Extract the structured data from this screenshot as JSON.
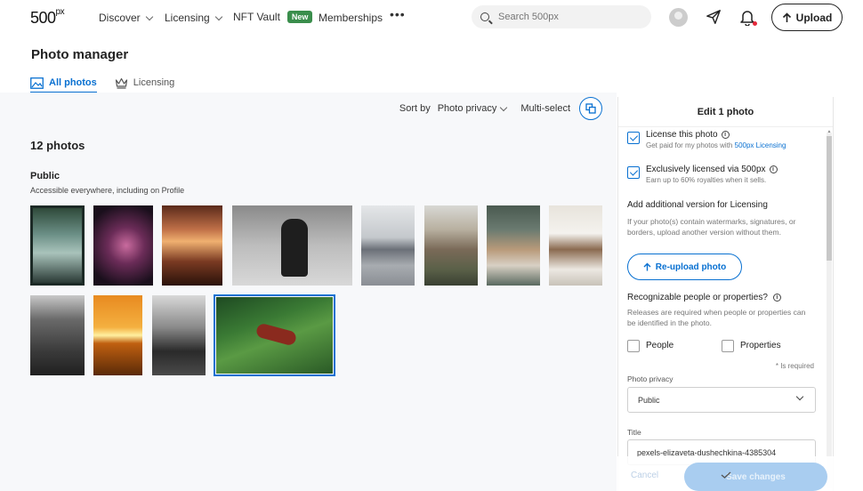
{
  "nav": {
    "logo": "500",
    "logo_suffix": "px",
    "items": [
      {
        "label": "Discover",
        "dropdown": true
      },
      {
        "label": "Licensing",
        "dropdown": true
      },
      {
        "label": "NFT Vault",
        "badge": "New"
      },
      {
        "label": "Memberships"
      }
    ],
    "more": "•••",
    "search_placeholder": "Search 500px",
    "upload_label": "Upload"
  },
  "header": {
    "title": "Photo manager",
    "tabs": [
      {
        "label": "All photos",
        "active": true,
        "icon": "image-icon"
      },
      {
        "label": "Licensing",
        "active": false,
        "icon": "crown-icon"
      }
    ]
  },
  "toolbar": {
    "sort_prefix": "Sort by",
    "sort_value": "Photo privacy",
    "multi_select": "Multi-select"
  },
  "library": {
    "count_label": "12 photos",
    "section_title": "Public",
    "section_subtitle": "Accessible everywhere, including on Profile"
  },
  "panel": {
    "title": "Edit 1 photo",
    "license": {
      "label": "License this photo",
      "sub_prefix": "Get paid for my photos with",
      "sub_link": "500px Licensing",
      "checked": true
    },
    "exclusive": {
      "label": "Exclusively licensed via 500px",
      "sub": "Earn up to 60% royalties when it sells.",
      "checked": true
    },
    "alt_version_title": "Add additional version for Licensing",
    "alt_version_text": "If your photo(s) contain watermarks, signatures, or borders, upload another version without them.",
    "reupload_label": "Re-upload photo",
    "recognizable_title": "Recognizable people or properties?",
    "recognizable_text": "Releases are required when people or properties can be identified in the photo.",
    "people_label": "People",
    "properties_label": "Properties",
    "required_note": "* Is required",
    "privacy_label": "Photo privacy",
    "privacy_value": "Public",
    "title_label": "Title",
    "title_value": "pexels-elizaveta-dushechkina-4385304",
    "cancel_label": "Cancel",
    "save_label": "Save changes"
  },
  "colors": {
    "accent": "#0870d1",
    "new_badge": "#3a8e4c",
    "notification_dot": "#e5293b"
  }
}
